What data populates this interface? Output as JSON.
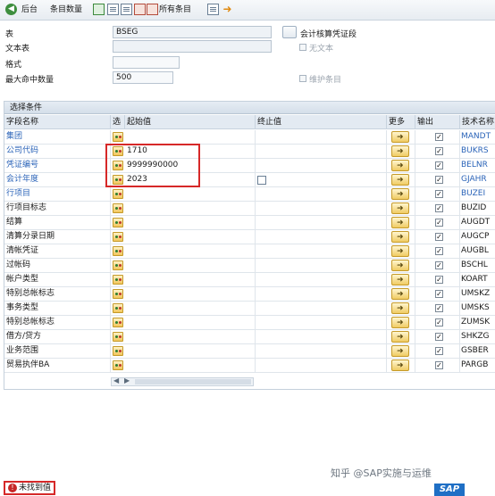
{
  "toolbar": {
    "back_label": "后台",
    "count_label": "条目数量",
    "all_items_label": "所有条目"
  },
  "form": {
    "table_label": "表",
    "table_value": "BSEG",
    "text_table_label": "文本表",
    "text_table_value": "",
    "layout_label": "格式",
    "layout_value": "",
    "max_hits_label": "最大命中数量",
    "max_hits_value": "500",
    "accounting_btn_label": "会计核算凭证段",
    "no_text_label": "无文本",
    "maintain_entries_label": "维护条目"
  },
  "selection": {
    "panel_title": "选择条件",
    "headers": {
      "field": "字段名称",
      "sel": "选",
      "low": "起始值",
      "high": "终止值",
      "more": "更多",
      "output": "输出",
      "tech": "技术名称"
    },
    "rows": [
      {
        "name": "集团",
        "low": "",
        "tech": "MANDT",
        "checked": "✓"
      },
      {
        "name": "公司代码",
        "low": "1710",
        "tech": "BUKRS",
        "checked": "✓"
      },
      {
        "name": "凭证编号",
        "low": "9999990000",
        "tech": "BELNR",
        "checked": "✓"
      },
      {
        "name": "会计年度",
        "low": "2023",
        "tech": "GJAHR",
        "checked": "✓"
      },
      {
        "name": "行项目",
        "low": "",
        "tech": "BUZEI",
        "checked": "✓"
      },
      {
        "name": "行项目标志",
        "low": "",
        "tech": "BUZID",
        "checked": "✓"
      },
      {
        "name": "结算",
        "low": "",
        "tech": "AUGDT",
        "checked": "✓"
      },
      {
        "name": "清算分录日期",
        "low": "",
        "tech": "AUGCP",
        "checked": "✓"
      },
      {
        "name": "清帐凭证",
        "low": "",
        "tech": "AUGBL",
        "checked": "✓"
      },
      {
        "name": "过帐码",
        "low": "",
        "tech": "BSCHL",
        "checked": "✓"
      },
      {
        "name": "帐户类型",
        "low": "",
        "tech": "KOART",
        "checked": "✓"
      },
      {
        "name": "特别总帐标志",
        "low": "",
        "tech": "UMSKZ",
        "checked": "✓"
      },
      {
        "name": "事务类型",
        "low": "",
        "tech": "UMSKS",
        "checked": "✓"
      },
      {
        "name": "特别总帐标志",
        "low": "",
        "tech": "ZUMSK",
        "checked": "✓"
      },
      {
        "name": "借方/贷方",
        "low": "",
        "tech": "SHKZG",
        "checked": "✓"
      },
      {
        "name": "业务范围",
        "low": "",
        "tech": "GSBER",
        "checked": "✓"
      },
      {
        "name": "贸易执伴BA",
        "low": "",
        "tech": "PARGB",
        "checked": "✓"
      }
    ]
  },
  "status": {
    "message": "未找到值",
    "icon": "!"
  },
  "watermark": "知乎 @SAP实施与运维",
  "sap_logo": "SAP"
}
